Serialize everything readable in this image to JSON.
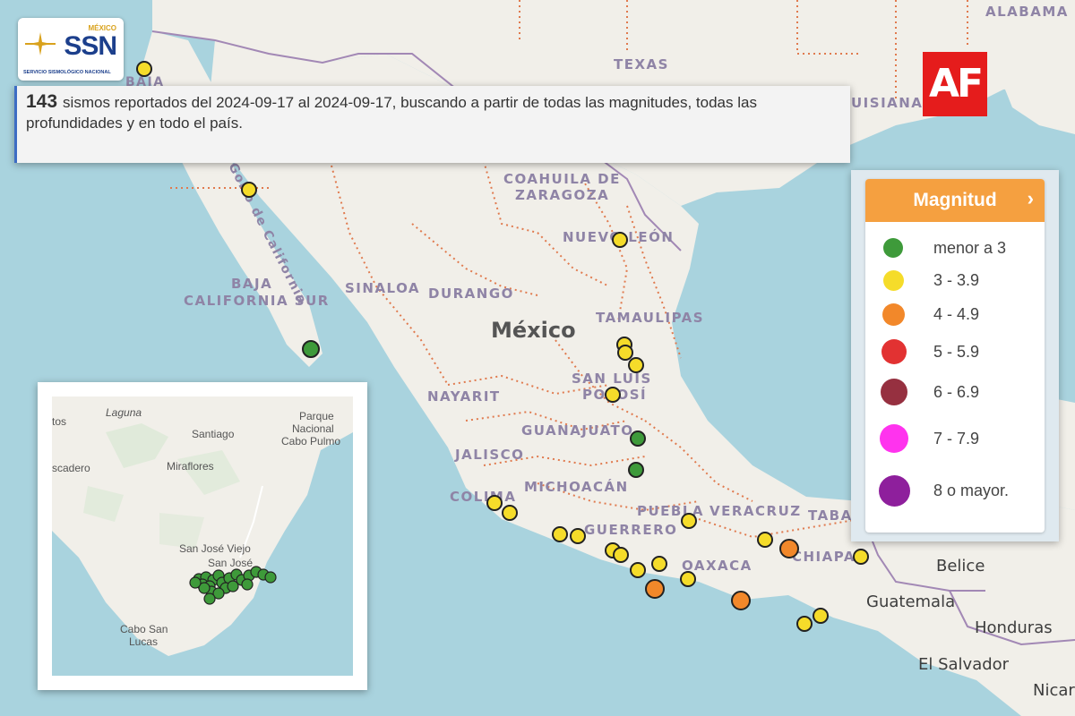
{
  "header": {
    "agency_country": "MÉXICO",
    "agency_short": "SSN",
    "agency_name": "SERVICIO SISMOLÓGICO NACIONAL",
    "brand_logo_text": "AF",
    "brand_color": "#e51c1c"
  },
  "summary": {
    "count": "143",
    "text_line1": "sismos reportados del 2024-09-17 al 2024-09-17, buscando a partir de todas las magnitudes, todas las",
    "text_line2": "profundidades y en todo el país."
  },
  "legend": {
    "title": "Magnitud",
    "toggle_icon": "chevron-right-icon",
    "items": [
      {
        "label": "menor a 3",
        "color": "#3e9a3a"
      },
      {
        "label": "3 - 3.9",
        "color": "#f5dc2a"
      },
      {
        "label": "4 - 4.9",
        "color": "#f2882a"
      },
      {
        "label": "5 - 5.9",
        "color": "#e23232"
      },
      {
        "label": "6 - 6.9",
        "color": "#963040"
      },
      {
        "label": "7 - 7.9",
        "color": "#ff33ee"
      },
      {
        "label": "8 o mayor.",
        "color": "#8e1f9c"
      }
    ]
  },
  "map_labels": {
    "texas": "TEXAS",
    "alabama": "ALABAMA",
    "louisiana": "UISIANA",
    "baja": "BAJA",
    "golfo": "Golfo de California",
    "coahuila1": "COAHUILA DE",
    "coahuila2": "ZARAGOZA",
    "nuevo_leon": "NUEVO LEÓN",
    "baja_sur1": "BAJA",
    "baja_sur2": "CALIFORNIA SUR",
    "sinaloa": "SINALOA",
    "durango": "DURANGO",
    "mexico": "México",
    "tamaulipas": "TAMAULIPAS",
    "nayarit": "NAYARIT",
    "san_luis1": "SAN LUIS",
    "san_luis2": "POTOSÍ",
    "guanajuato": "GUANAJUATO",
    "jalisco": "JALISCO",
    "colima": "COLIMA",
    "michoacan": "MICHOACÁN",
    "puebla": "PUEBLA",
    "veracruz": "VERACRUZ",
    "tabasco": "TABA",
    "guerrero": "GUERRERO",
    "oaxaca": "OAXACA",
    "chiapas": "CHIAPAS",
    "belice": "Belice",
    "guatemala": "Guatemala",
    "honduras": "Honduras",
    "el_salvador": "El Salvador",
    "nicaragua": "Nicar"
  },
  "inset_labels": {
    "laguna": "Laguna",
    "santiago": "Santiago",
    "parque1": "Parque",
    "parque2": "Nacional",
    "parque3": "Cabo Pulmo",
    "tos": "tos",
    "miraflores": "Miraflores",
    "escadero": "scadero",
    "san_jose_viejo": "San José Viejo",
    "san_jose": "San José",
    "cabo1": "Cabo San",
    "cabo2": "Lucas"
  }
}
